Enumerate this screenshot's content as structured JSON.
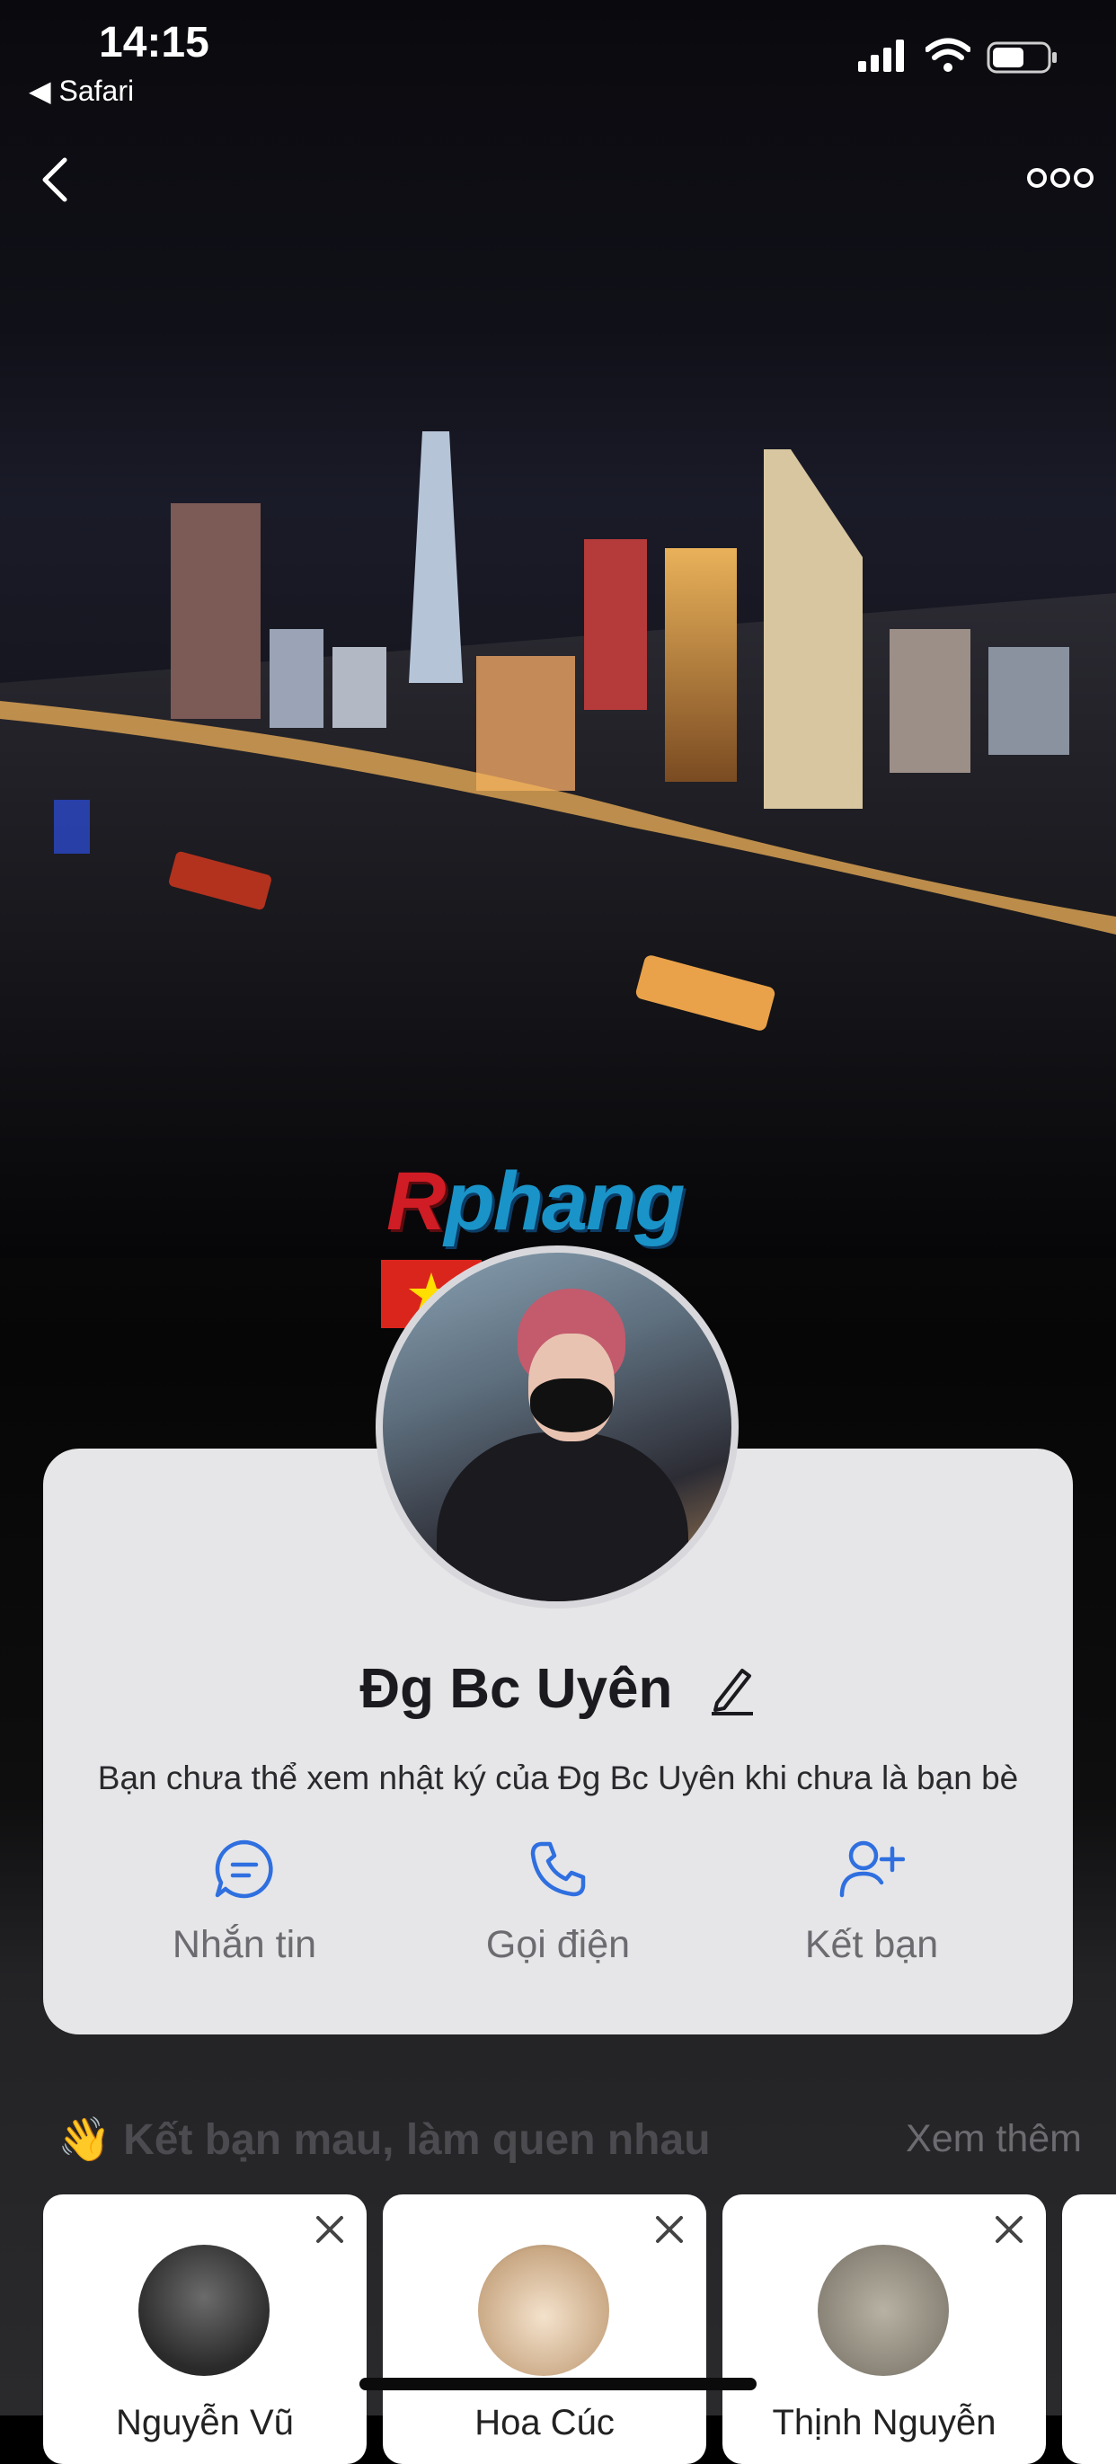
{
  "status_bar": {
    "time": "14:15",
    "back_app": "◀ Safari"
  },
  "watermark": {
    "first": "R",
    "rest": "phang"
  },
  "profile": {
    "name": "Đg Bc Uyên",
    "notice": "Bạn chưa thể xem nhật ký của Đg Bc Uyên khi chưa là bạn bè"
  },
  "actions": [
    {
      "label": "Nhắn tin",
      "icon": "chat-bubble-icon"
    },
    {
      "label": "Gọi điện",
      "icon": "phone-icon"
    },
    {
      "label": "Kết bạn",
      "icon": "add-friend-icon"
    }
  ],
  "suggestions": {
    "title": "👋 Kết bạn mau, làm quen nhau",
    "more": "Xem thêm",
    "items": [
      {
        "name": "Nguyễn Vũ"
      },
      {
        "name": "Hoa Cúc"
      },
      {
        "name": "Thịnh Nguyễn"
      }
    ]
  },
  "colors": {
    "accent": "#2f6fe0",
    "card": "#e6e6e8",
    "flag_red": "#da251d",
    "flag_star": "#ffde00"
  }
}
